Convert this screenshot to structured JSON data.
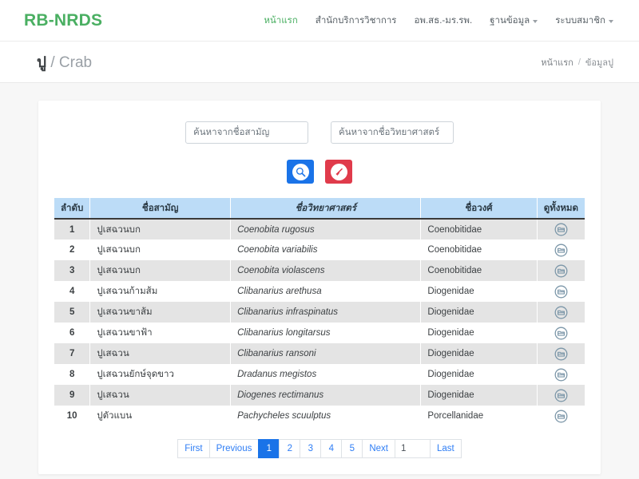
{
  "navbar": {
    "brand": "RB-NRDS",
    "brand_color": "#4aaf62",
    "links": [
      {
        "label": "หน้าแรก",
        "active": true,
        "caret": false
      },
      {
        "label": "สำนักบริการวิชาการ",
        "active": false,
        "caret": false
      },
      {
        "label": "อพ.สธ.-มร.รพ.",
        "active": false,
        "caret": false
      },
      {
        "label": "ฐานข้อมูล",
        "active": false,
        "caret": true
      },
      {
        "label": "ระบบสมาชิก",
        "active": false,
        "caret": true
      }
    ]
  },
  "page_head": {
    "title_th": "ปู",
    "title_sep": " / ",
    "title_en": "Crab",
    "breadcrumb": {
      "home": "หน้าแรก",
      "separator": "/",
      "current": "ข้อมูลปู"
    }
  },
  "search": {
    "common_name_placeholder": "ค้นหาจากชื่อสามัญ",
    "common_name_value": "",
    "scientific_name_placeholder": "ค้นหาจากชื่อวิทยาศาสตร์",
    "scientific_name_value": "",
    "search_button_icon": "search-icon",
    "search_button_color": "#1a73e8",
    "clear_button_icon": "broom-icon",
    "clear_button_color": "#e03b4b"
  },
  "table": {
    "header_color": "#bcdcf7",
    "columns": [
      "ลำดับ",
      "ชื่อสามัญ",
      "ชื่อวิทยาศาสตร์",
      "ชื่อวงศ์",
      "ดูทั้งหมด"
    ],
    "rows": [
      {
        "index": "1",
        "common": "ปูเสฉวนบก",
        "scientific": "Coenobita rugosus",
        "family": "Coenobitidae",
        "action_icon": "folder-icon"
      },
      {
        "index": "2",
        "common": "ปูเสฉวนบก",
        "scientific": "Coenobita variabilis",
        "family": "Coenobitidae",
        "action_icon": "folder-icon"
      },
      {
        "index": "3",
        "common": "ปูเสฉวนบก",
        "scientific": "Coenobita violascens",
        "family": "Coenobitidae",
        "action_icon": "folder-icon"
      },
      {
        "index": "4",
        "common": "ปูเสฉวนก้ามส้ม",
        "scientific": "Clibanarius arethusa",
        "family": "Diogenidae",
        "action_icon": "folder-icon"
      },
      {
        "index": "5",
        "common": "ปูเสฉวนขาส้ม",
        "scientific": "Clibanarius infraspinatus",
        "family": "Diogenidae",
        "action_icon": "folder-icon"
      },
      {
        "index": "6",
        "common": "ปูเสฉวนขาฟ้า",
        "scientific": "Clibanarius longitarsus",
        "family": "Diogenidae",
        "action_icon": "folder-icon"
      },
      {
        "index": "7",
        "common": "ปูเสฉวน",
        "scientific": "Clibanarius ransoni",
        "family": "Diogenidae",
        "action_icon": "folder-icon"
      },
      {
        "index": "8",
        "common": "ปูเสฉวนยักษ์จุดขาว",
        "scientific": "Dradanus megistos",
        "family": "Diogenidae",
        "action_icon": "folder-icon"
      },
      {
        "index": "9",
        "common": "ปูเสฉวน",
        "scientific": "Diogenes rectimanus",
        "family": "Diogenidae",
        "action_icon": "folder-icon"
      },
      {
        "index": "10",
        "common": "ปูตัวแบน",
        "scientific": "Pachycheles scuulptus",
        "family": "Porcellanidae",
        "action_icon": "folder-icon"
      }
    ]
  },
  "pagination": {
    "first": "First",
    "previous": "Previous",
    "pages": [
      "1",
      "2",
      "3",
      "4",
      "5"
    ],
    "active_page": "1",
    "next": "Next",
    "page_input_value": "1",
    "last": "Last",
    "active_color": "#1a73e8"
  }
}
